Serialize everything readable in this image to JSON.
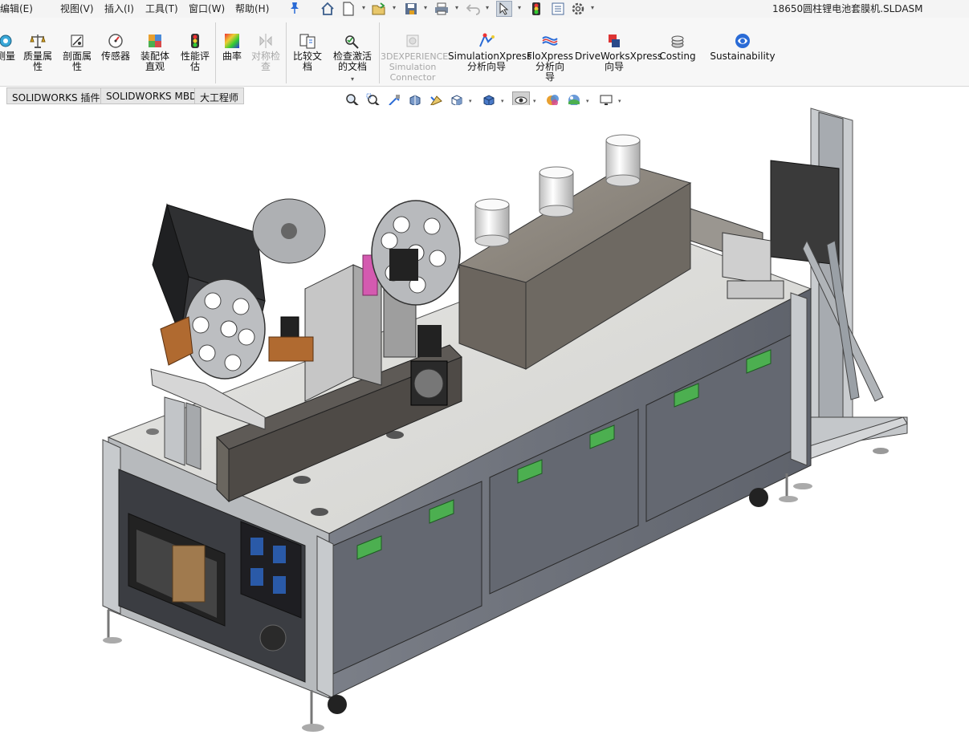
{
  "menu": {
    "items": [
      "编辑(E)",
      "视图(V)",
      "插入(I)",
      "工具(T)",
      "窗口(W)",
      "帮助(H)"
    ]
  },
  "document": {
    "title": "18650圆柱锂电池套膜机.SLDASM"
  },
  "quick_access": {
    "icons": [
      "home-icon",
      "new-document-icon",
      "open-icon",
      "save-icon",
      "print-icon",
      "undo-icon",
      "select-icon",
      "rebuild-icon",
      "file-properties-icon",
      "options-icon"
    ]
  },
  "ribbon": {
    "buttons": [
      {
        "label": "测量",
        "enabled": true
      },
      {
        "label": "质量属\n性",
        "enabled": true
      },
      {
        "label": "剖面属\n性",
        "enabled": true
      },
      {
        "label": "传感器",
        "enabled": true
      },
      {
        "label": "装配体\n直观",
        "enabled": true
      },
      {
        "label": "性能评\n估",
        "enabled": true
      },
      {
        "label": "曲率",
        "enabled": true
      },
      {
        "label": "对称检\n查",
        "enabled": false
      },
      {
        "label": "比较文\n档",
        "enabled": true
      },
      {
        "label": "检查激活\n的文档",
        "enabled": true
      },
      {
        "label": "3DEXPERIENCE\nSimulation\nConnector",
        "enabled": false
      },
      {
        "label": "SimulationXpress\n分析向导",
        "enabled": true
      },
      {
        "label": "FloXpress\n分析向\n导",
        "enabled": true
      },
      {
        "label": "DriveWorksXpress\n向导",
        "enabled": true
      },
      {
        "label": "Costing",
        "enabled": true
      },
      {
        "label": "Sustainability",
        "enabled": true
      }
    ]
  },
  "tabs": [
    "SOLIDWORKS 插件",
    "SOLIDWORKS MBD",
    "大工程师"
  ],
  "hud": {
    "icons": [
      "zoom-to-fit-icon",
      "zoom-to-area-icon",
      "previous-view-icon",
      "section-view-icon",
      "dynamic-annotation-icon",
      "view-orientation-icon",
      "display-style-icon",
      "hide-show-items-icon",
      "edit-appearance-icon",
      "apply-scene-icon",
      "view-settings-icon"
    ]
  },
  "colors": {
    "frame": "#b9bcbf",
    "panel": "#6d7078",
    "cover": "#74706a",
    "handle": "#4caf50",
    "accent_pink": "#d45ab0"
  }
}
